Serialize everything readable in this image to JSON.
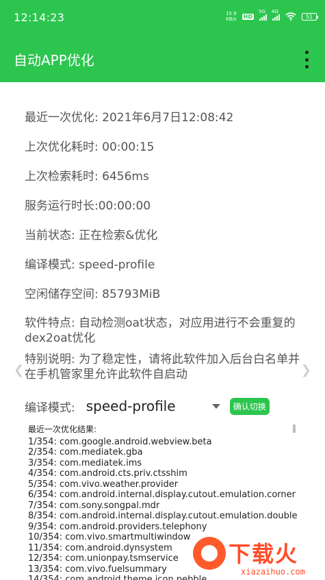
{
  "status": {
    "time": "12:14:23",
    "net_speed_value": "15.9",
    "net_speed_unit": "KB/s",
    "hd_badge": "HD",
    "signal1_label": "5G",
    "signal2_label": "4G",
    "battery": "51"
  },
  "app_bar": {
    "title": "自动APP优化",
    "menu_icon": "more-vert-icon"
  },
  "info": {
    "last_optimize": "最近一次优化: 2021年6月7日12:08:42",
    "last_optimize_duration": "上次优化耗时: 00:00:15",
    "last_scan_duration": "上次检索耗时: 6456ms",
    "service_uptime": "服务运行时长:00:00:00",
    "current_status": "当前状态: 正在检索&优化",
    "compile_mode": "编译模式: speed-profile",
    "free_storage": "空闲储存空间: 85793MiB",
    "features": "软件特点: 自动检测oat状态，对应用进行不会重复的dex2oat优化",
    "special_note": "特别说明: 为了稳定性，请将此软件加入后台白名单并在手机管家里允许此软件自启动"
  },
  "mode_selector": {
    "label": "编译模式:",
    "selected": "speed-profile",
    "confirm_label": "确认切换"
  },
  "results": {
    "title": "最近一次优化结果:",
    "items": [
      "1/354: com.google.android.webview.beta",
      "2/354: com.mediatek.gba",
      "3/354: com.mediatek.ims",
      "4/354: com.android.cts.priv.ctsshim",
      "5/354: com.vivo.weather.provider",
      "6/354: com.android.internal.display.cutout.emulation.corner",
      "7/354: com.sony.songpal.mdr",
      "8/354: com.android.internal.display.cutout.emulation.double",
      "9/354: com.android.providers.telephony",
      "10/354: com.vivo.smartmultiwindow",
      "11/354: com.android.dynsystem",
      "12/354: com.unionpay.tsmservice",
      "13/354: com.vivo.fuelsummary",
      "14/354: com.android.theme.icon.pebble"
    ]
  },
  "watermark": {
    "text": "下载火",
    "domain": "xiazaihuo.com"
  },
  "colors": {
    "primary": "#2cc64f",
    "watermark": "#ff4d2a"
  }
}
